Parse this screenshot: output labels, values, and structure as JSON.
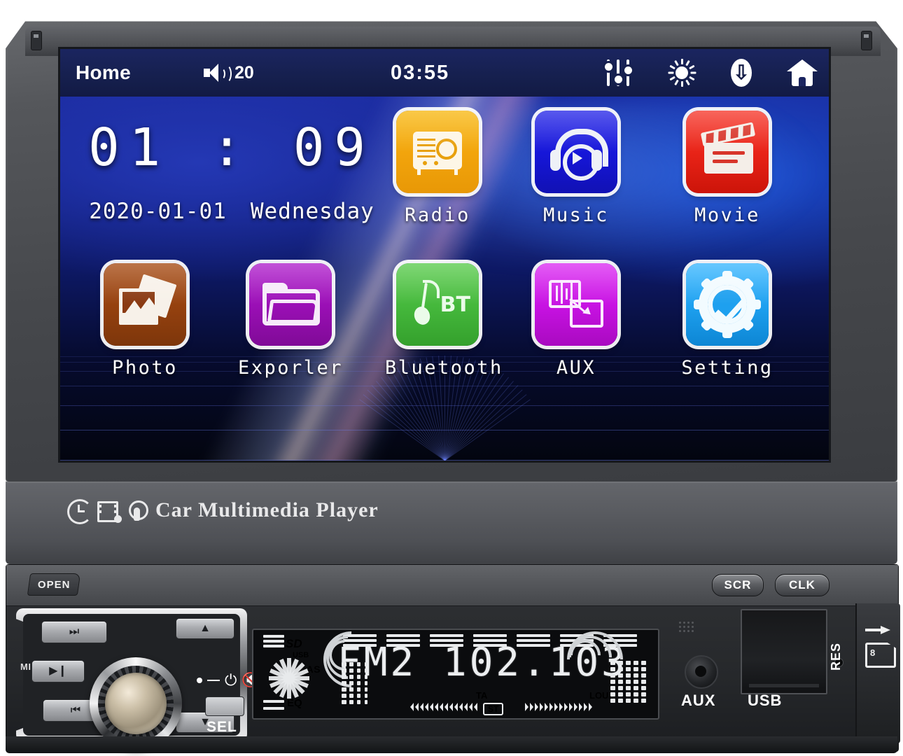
{
  "device": {
    "brand_text": "Car Multimedia Player",
    "brand_icons": [
      "clock-icon",
      "film-music-icon",
      "touch-hand-icon"
    ]
  },
  "screen": {
    "statusbar": {
      "home_label": "Home",
      "volume_icon": "speaker-icon",
      "volume_value": "20",
      "clock": "03:55",
      "icons": [
        {
          "name": "equalizer-icon",
          "label": "EQ"
        },
        {
          "name": "brightness-icon",
          "label": "Brightness"
        },
        {
          "name": "bluetooth-icon",
          "label": "Bluetooth"
        },
        {
          "name": "home-icon",
          "label": "Home"
        }
      ]
    },
    "clock_widget": {
      "time": "01 : 09",
      "date": "2020-01-01",
      "weekday": "Wednesday"
    },
    "apps": [
      {
        "label": "Radio",
        "icon": "radio-icon",
        "color": "#f2a40c",
        "row": 1,
        "col": 2
      },
      {
        "label": "Music",
        "icon": "headphones-icon",
        "color": "#1616d8",
        "row": 1,
        "col": 3
      },
      {
        "label": "Movie",
        "icon": "clapboard-icon",
        "color": "#e82317",
        "row": 1,
        "col": 4
      },
      {
        "label": "Photo",
        "icon": "photo-icon",
        "color": "#95410f",
        "row": 2,
        "col": 0
      },
      {
        "label": "Exporler",
        "icon": "folder-icon",
        "color": "#9a0fb5",
        "row": 2,
        "col": 1
      },
      {
        "label": "Bluetooth",
        "icon": "bt-note-icon",
        "color": "#45b83c",
        "row": 2,
        "col": 2
      },
      {
        "label": "AUX",
        "icon": "aux-icon",
        "color": "#c712e2",
        "row": 2,
        "col": 3
      },
      {
        "label": "Setting",
        "icon": "gear-check-icon",
        "color": "#1ea0ef",
        "row": 2,
        "col": 4
      }
    ]
  },
  "panel": {
    "open_button": "OPEN",
    "scr_button": "SCR",
    "clk_button": "CLK",
    "sel_button": "SEL",
    "mic_label": "MIC",
    "transport": [
      {
        "name": "next-track-button",
        "glyph": "⏭"
      },
      {
        "name": "play-pause-button",
        "glyph": "▶❙"
      },
      {
        "name": "prev-track-button",
        "glyph": "⏮"
      },
      {
        "name": "up-button",
        "glyph": "▲"
      },
      {
        "name": "down-button",
        "glyph": "▼"
      }
    ],
    "power_mute_icon": "power-mute-icon",
    "knob": "volume-knob"
  },
  "lcd": {
    "band": "FM2",
    "frequency": "102.103",
    "display_text": "FM2 102.103",
    "indicators": {
      "sd": "SD",
      "usb": "USB",
      "clas": "CLAS",
      "eq": "EQ",
      "ta": "TA",
      "st": "ST",
      "loud": "LOUD"
    }
  },
  "ports": {
    "aux_label": "AUX",
    "usb_label": "USB",
    "res_label": "RES",
    "sd_slot_icon": "sd-card-icon"
  },
  "colors": {
    "status_bar": "#16204f",
    "wallpaper_top": "#1a2a9e",
    "wallpaper_bottom": "#03050f",
    "body": "#4e5055",
    "lcd_bg": "#0b0c0e",
    "lcd_text": "#eceef0"
  }
}
